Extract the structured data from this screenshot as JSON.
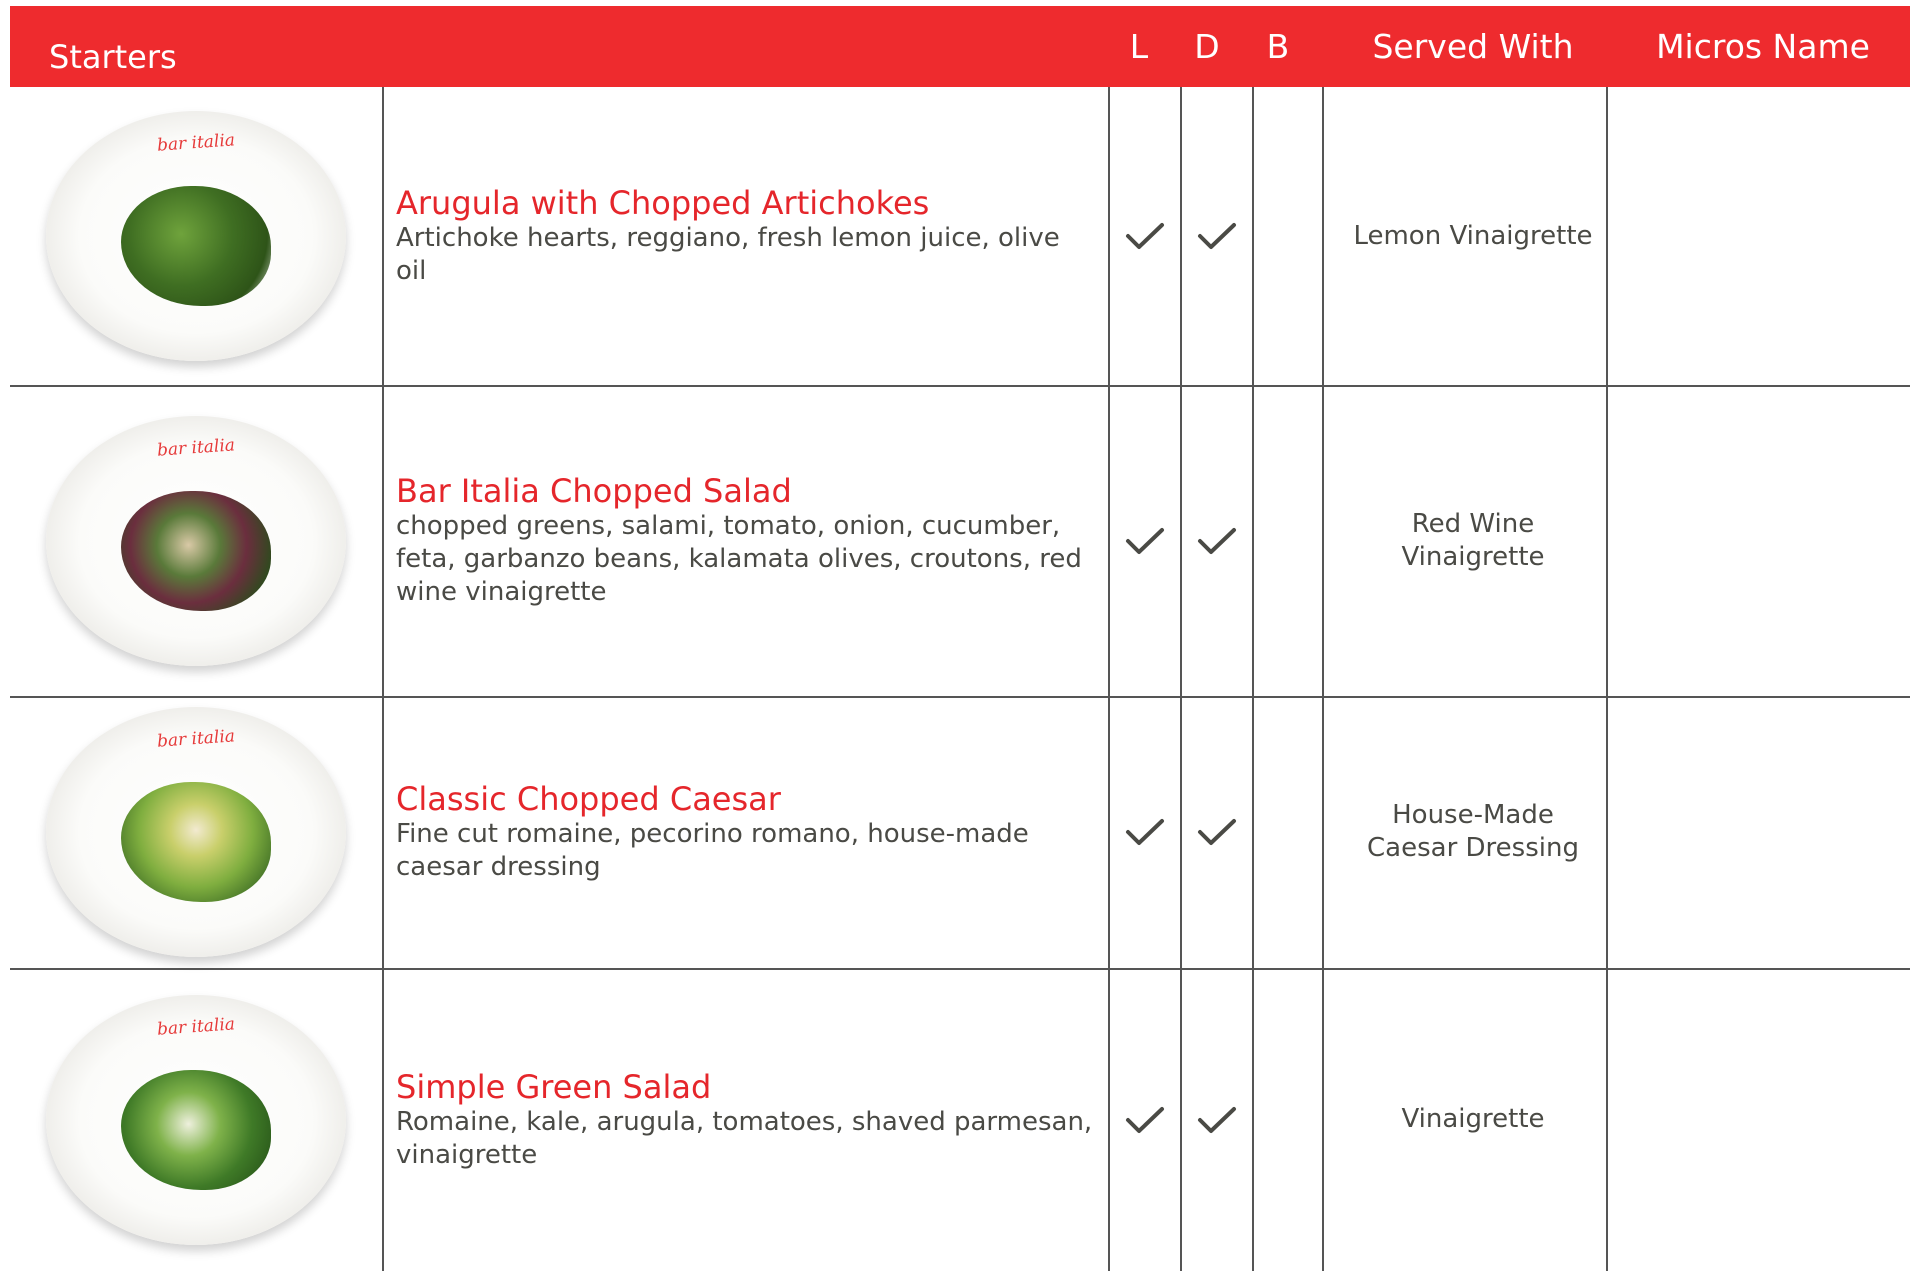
{
  "header": {
    "title": "Starters",
    "col_l": "L",
    "col_d": "D",
    "col_b": "B",
    "col_served": "Served With",
    "col_micros": "Micros Name"
  },
  "plate_brand": "bar italia",
  "colors": {
    "accent": "#ee2b2e",
    "dish_name": "#e5262b",
    "text": "#4a4a45"
  },
  "items": [
    {
      "name": "Arugula with Chopped Artichokes",
      "description": "Artichoke hearts, reggiano, fresh lemon juice, olive oil",
      "lunch": true,
      "dinner": true,
      "brunch": false,
      "served_with": "Lemon Vinaigrette",
      "micros_name": ""
    },
    {
      "name": "Bar Italia Chopped Salad",
      "description": "chopped greens, salami, tomato, onion, cucumber, feta, garbanzo beans, kalamata olives, croutons, red wine vinaigrette",
      "lunch": true,
      "dinner": true,
      "brunch": false,
      "served_with": "Red Wine Vinaigrette",
      "micros_name": ""
    },
    {
      "name": "Classic Chopped Caesar",
      "description": "Fine cut romaine, pecorino romano, house-made caesar dressing",
      "lunch": true,
      "dinner": true,
      "brunch": false,
      "served_with": "House-Made Caesar Dressing",
      "micros_name": ""
    },
    {
      "name": "Simple Green Salad",
      "description": "Romaine, kale, arugula, tomatoes, shaved parmesan, vinaigrette",
      "lunch": true,
      "dinner": true,
      "brunch": false,
      "served_with": "Vinaigrette",
      "micros_name": ""
    }
  ]
}
